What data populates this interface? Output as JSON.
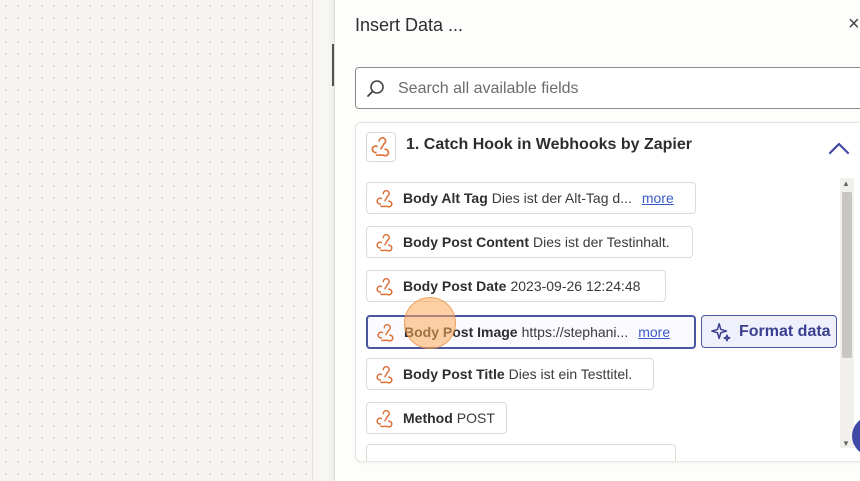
{
  "popup": {
    "title": "Insert Data ...",
    "close_label": "×"
  },
  "search": {
    "placeholder": "Search all available fields"
  },
  "step": {
    "title": "1. Catch Hook in Webhooks by Zapier",
    "icon": "webhook-icon"
  },
  "fields": [
    {
      "name": "Body Alt Tag",
      "value": "Dies ist der Alt-Tag d...",
      "more": "more"
    },
    {
      "name": "Body Post Content",
      "value": "Dies ist der Testinhalt."
    },
    {
      "name": "Body Post Date",
      "value": "2023-09-26 12:24:48"
    },
    {
      "name": "Body Post Image",
      "value": "https://stephani...",
      "more": "more"
    },
    {
      "name": "Body Post Title",
      "value": "Dies ist ein Testtitel."
    },
    {
      "name": "Method",
      "value": "POST"
    }
  ],
  "format_button": {
    "label": "Format data",
    "icon": "sparkle-icon"
  },
  "colors": {
    "accent": "#4a55a0",
    "webhook_icon": "#e0703a",
    "link": "#3a59c9"
  }
}
